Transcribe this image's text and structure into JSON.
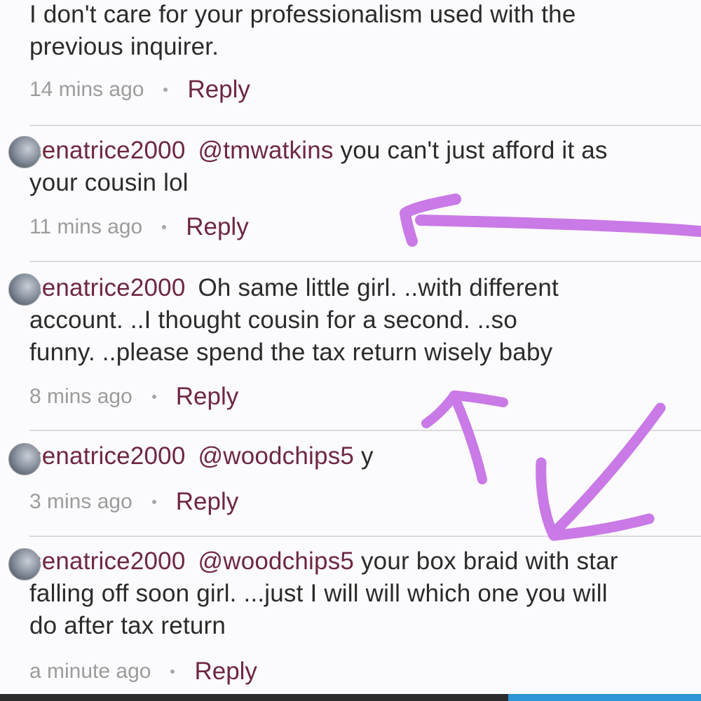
{
  "comments": [
    {
      "username": "",
      "mention": "",
      "text_line1": "I don't care for your professionalism used with the",
      "text_line2": "previous inquirer.",
      "time": "14 mins ago",
      "reply_label": "Reply"
    },
    {
      "username": "senatrice2000",
      "mention": "@tmwatkins",
      "text_line1_rest": " you can't just afford it as",
      "text_line2": "your cousin lol",
      "time": "11 mins ago",
      "reply_label": "Reply"
    },
    {
      "username": "senatrice2000",
      "mention": "",
      "text_line1_rest": "Oh same little girl. ..with different",
      "text_line2": "account. ..I thought cousin for a second. ..so",
      "text_line3": "funny. ..please spend the tax return wisely baby",
      "time": "8 mins ago",
      "reply_label": "Reply"
    },
    {
      "username": "senatrice2000",
      "mention": "@woodchips5",
      "text_line1_rest": " y",
      "time": "3 mins ago",
      "reply_label": "Reply"
    },
    {
      "username": "senatrice2000",
      "mention": "@woodchips5",
      "text_line1_rest": " your box braid with star",
      "text_line2": "falling off soon girl. ...just I will will which one you will",
      "text_line3": "do after tax return",
      "time": "a minute ago",
      "reply_label": "Reply"
    }
  ],
  "colors": {
    "username": "#6e2742",
    "reply": "#6e2742",
    "text": "#2b2b2b",
    "meta": "#9c9c9c",
    "annotation_arrow": "#c97ae6",
    "bottom_bar": "#2c2c2c",
    "bottom_bar_accent": "#2b95d6"
  }
}
